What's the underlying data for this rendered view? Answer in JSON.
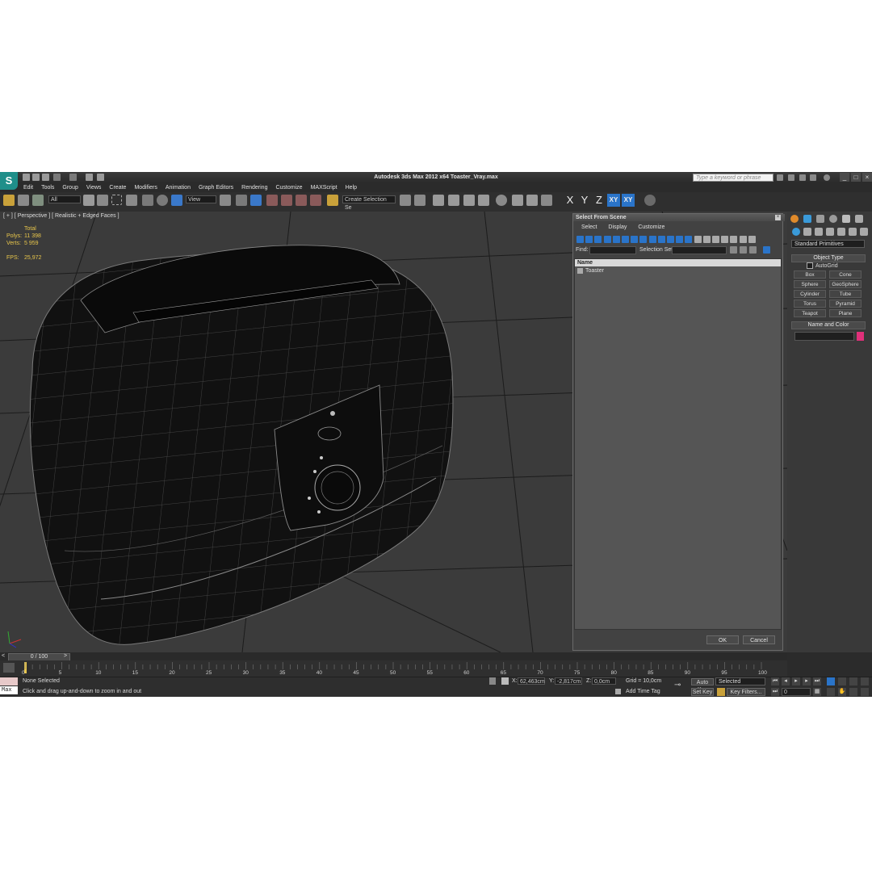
{
  "window": {
    "title": "Autodesk 3ds Max  2012 x64     Toaster_Vray.max",
    "search_placeholder": "Type a keyword or phrase",
    "app_logo": "3ds-max-logo"
  },
  "menu": [
    "Edit",
    "Tools",
    "Group",
    "Views",
    "Create",
    "Modifiers",
    "Animation",
    "Graph Editors",
    "Rendering",
    "Customize",
    "MAXScript",
    "Help"
  ],
  "toolbar": {
    "selection_filter": "All",
    "reference_coord": "View",
    "create_selection_set": "Create Selection Se",
    "axis": [
      "X",
      "Y",
      "Z",
      "XY",
      "XY"
    ]
  },
  "viewport": {
    "label": "[ + ] [ Perspective ] [ Realistic + Edged Faces ]",
    "stats": {
      "total_label": "Total",
      "polys_label": "Polys:",
      "polys_value": "11 398",
      "verts_label": "Verts:",
      "verts_value": "5 959",
      "fps_label": "FPS:",
      "fps_value": "25,972"
    }
  },
  "dialog": {
    "title": "Select From Scene",
    "menu": [
      "Select",
      "Display",
      "Customize"
    ],
    "find_label": "Find:",
    "selection_set_label": "Selection Set:",
    "column_name": "Name",
    "items": [
      "Toaster"
    ],
    "ok": "OK",
    "cancel": "Cancel"
  },
  "command_panel": {
    "category": "Standard Primitives",
    "object_type_title": "Object Type",
    "autogrid": "AutoGrid",
    "buttons": [
      "Box",
      "Cone",
      "Sphere",
      "GeoSphere",
      "Cylinder",
      "Tube",
      "Torus",
      "Pyramid",
      "Teapot",
      "Plane"
    ],
    "name_color_title": "Name and Color",
    "object_color": "#e0307a"
  },
  "timeline": {
    "frame_counter": "0 / 100",
    "ticks": [
      "0",
      "5",
      "10",
      "15",
      "20",
      "25",
      "30",
      "35",
      "40",
      "45",
      "50",
      "55",
      "60",
      "65",
      "70",
      "75",
      "80",
      "85",
      "90",
      "95",
      "100"
    ]
  },
  "status": {
    "max_label": "Max",
    "selection": "None Selected",
    "prompt": "Click and drag up-and-down to zoom in and out",
    "x_label": "X:",
    "x_value": "62,463cm",
    "y_label": "Y:",
    "y_value": "-2,817cm",
    "z_label": "Z:",
    "z_value": "0,0cm",
    "grid": "Grid = 10,0cm",
    "add_time_tag": "Add Time Tag",
    "auto_key": "Auto Key",
    "set_key": "Set Key",
    "key_mode": "Selected",
    "key_filters": "Key Filters...",
    "current_frame": "0"
  },
  "colors": {
    "accent": "#2a74c9",
    "stats": "#e8c64b",
    "viewport_bg": "#3b3b3b"
  }
}
